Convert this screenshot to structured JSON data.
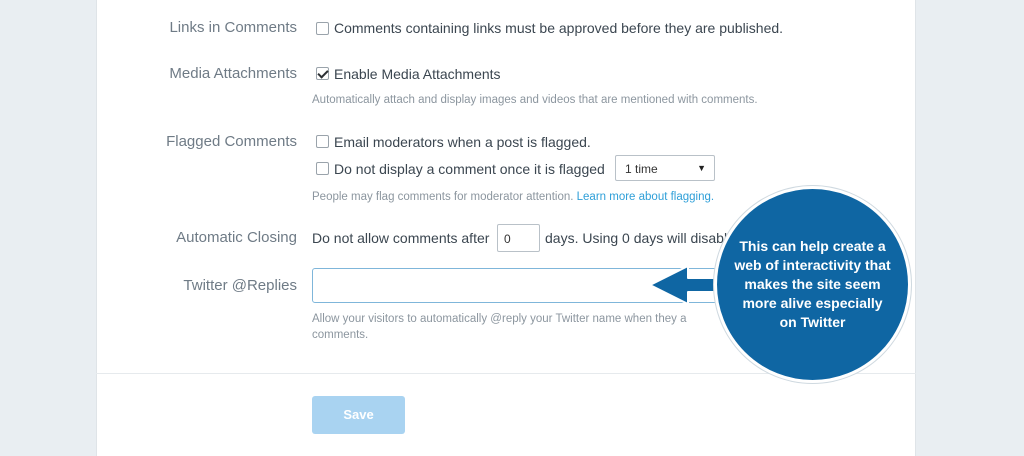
{
  "settings": {
    "links": {
      "label": "Links in Comments",
      "option": "Comments containing links must be approved before they are published.",
      "checked": false
    },
    "media": {
      "label": "Media Attachments",
      "option": "Enable Media Attachments",
      "checked": true,
      "hint": "Automatically attach and display images and videos that are mentioned with comments."
    },
    "flagged": {
      "label": "Flagged Comments",
      "option_email": "Email moderators when a post is flagged.",
      "option_hide": "Do not display a comment once it is flagged",
      "select_value": "1 time",
      "hint": "People may flag comments for moderator attention.",
      "hint_link": "Learn more about flagging."
    },
    "closing": {
      "label": "Automatic Closing",
      "prefix": "Do not allow comments after",
      "value": "0",
      "suffix": "days. Using 0 days will disable"
    },
    "twitter": {
      "label": "Twitter @Replies",
      "value": "",
      "hint_line1": "Allow your visitors to automatically @reply your Twitter name when they a",
      "hint_line2": "comments."
    }
  },
  "save_label": "Save",
  "callout": {
    "text": "This can help create a web of interactivity that makes the site seem more alive especially on Twitter",
    "color": "#0f66a3"
  },
  "colors": {
    "link": "#2e9fd8",
    "save_button": "#a9d3f1",
    "focus_border": "#7fb6da"
  }
}
